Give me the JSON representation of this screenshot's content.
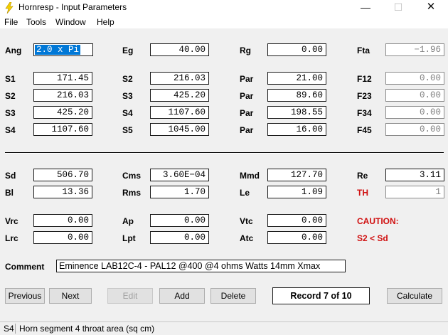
{
  "window": {
    "title": "Hornresp - Input Parameters",
    "min": "—",
    "max": "☐",
    "close": "✕"
  },
  "menu": [
    "File",
    "Tools",
    "Window",
    "Help"
  ],
  "params": {
    "Ang": "2.0 x Pi",
    "Eg": "40.00",
    "Rg": "0.00",
    "Fta": "−1.96",
    "S1": "171.45",
    "S2a": "216.03",
    "Par1": "21.00",
    "F12": "0.00",
    "S2": "216.03",
    "S3a": "425.20",
    "Par2": "89.60",
    "F23": "0.00",
    "S3": "425.20",
    "S4a": "1107.60",
    "Par3": "198.55",
    "F34": "0.00",
    "S4": "1107.60",
    "S5": "1045.00",
    "Par4": "16.00",
    "F45": "0.00",
    "Sd": "506.70",
    "Cms": "3.60E−04",
    "Mmd": "127.70",
    "Re": "3.11",
    "Bl": "13.36",
    "Rms": "1.70",
    "Le": "1.09",
    "TH": "1",
    "Vrc": "0.00",
    "Ap": "0.00",
    "Vtc": "0.00",
    "Lrc": "0.00",
    "Lpt": "0.00",
    "Atc": "0.00"
  },
  "labels": {
    "Ang": "Ang",
    "Eg": "Eg",
    "Rg": "Rg",
    "Fta": "Fta",
    "S1": "S1",
    "S2": "S2",
    "S3": "S3",
    "S4": "S4",
    "S5": "S5",
    "Par": "Par",
    "F12": "F12",
    "F23": "F23",
    "F34": "F34",
    "F45": "F45",
    "Sd": "Sd",
    "Cms": "Cms",
    "Mmd": "Mmd",
    "Re": "Re",
    "Bl": "Bl",
    "Rms": "Rms",
    "Le": "Le",
    "TH": "TH",
    "Vrc": "Vrc",
    "Ap": "Ap",
    "Vtc": "Vtc",
    "Lrc": "Lrc",
    "Lpt": "Lpt",
    "Atc": "Atc",
    "Comment": "Comment"
  },
  "caution": {
    "title": "CAUTION:",
    "message": "S2 < Sd"
  },
  "comment": "Eminence LAB12C-4 - PAL12  @400 @4 ohms Watts 14mm Xmax",
  "buttons": {
    "previous": "Previous",
    "next": "Next",
    "edit": "Edit",
    "add": "Add",
    "delete": "Delete",
    "calculate": "Calculate"
  },
  "record": "Record 7 of 10",
  "status": {
    "field": "S4",
    "description": "Horn segment 4 throat area  (sq cm)"
  },
  "colors": {
    "accent": "#0078d7",
    "warning": "#d01010"
  }
}
